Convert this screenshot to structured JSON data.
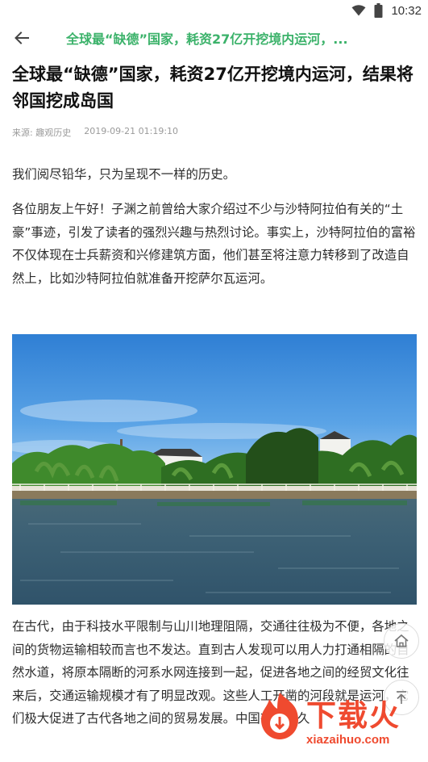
{
  "status_bar": {
    "time": "10:32"
  },
  "app_bar": {
    "title": "全球最“缺德”国家，耗资27亿开挖境内运河，..."
  },
  "article": {
    "title": "全球最“缺德”国家，耗资27亿开挖境内运河，结果将邻国挖成岛国",
    "source_label": "来源:",
    "source": "趣观历史",
    "timestamp": "2019-09-21 01:19:10",
    "paragraphs": [
      "我们阅尽铅华，只为呈现不一样的历史。",
      "各位朋友上午好！子渊之前曾给大家介绍过不少与沙特阿拉伯有关的“土豪”事迹，引发了读者的强烈兴趣与热烈讨论。事实上，沙特阿拉伯的富裕不仅体现在士兵薪资和兴修建筑方面，他们甚至将注意力转移到了改造自然上，比如沙特阿拉伯就准备开挖萨尔瓦运河。",
      "在古代，由于科技水平限制与山川地理阻隔，交通往往极为不便，各地之间的货物运输相较而言也不发达。直到古人发现可以用人力打通相隔的自然水道，将原本隔断的河系水网连接到一起，促进各地之间的经贸文化往来后，交通运输规模才有了明显改观。这些人工开凿的河段就是运河，它们极大促进了古代各地之间的贸易发展。中国有着悠久"
    ]
  },
  "image": {
    "alt": "canal-scene"
  },
  "floating": {
    "home_icon": "home-icon",
    "top_icon": "arrow-up-icon"
  },
  "watermark": {
    "text": "下载火",
    "url": "xiazaihuo.com"
  },
  "colors": {
    "accent": "#3bb26a",
    "watermark": "#ef4a2f"
  }
}
